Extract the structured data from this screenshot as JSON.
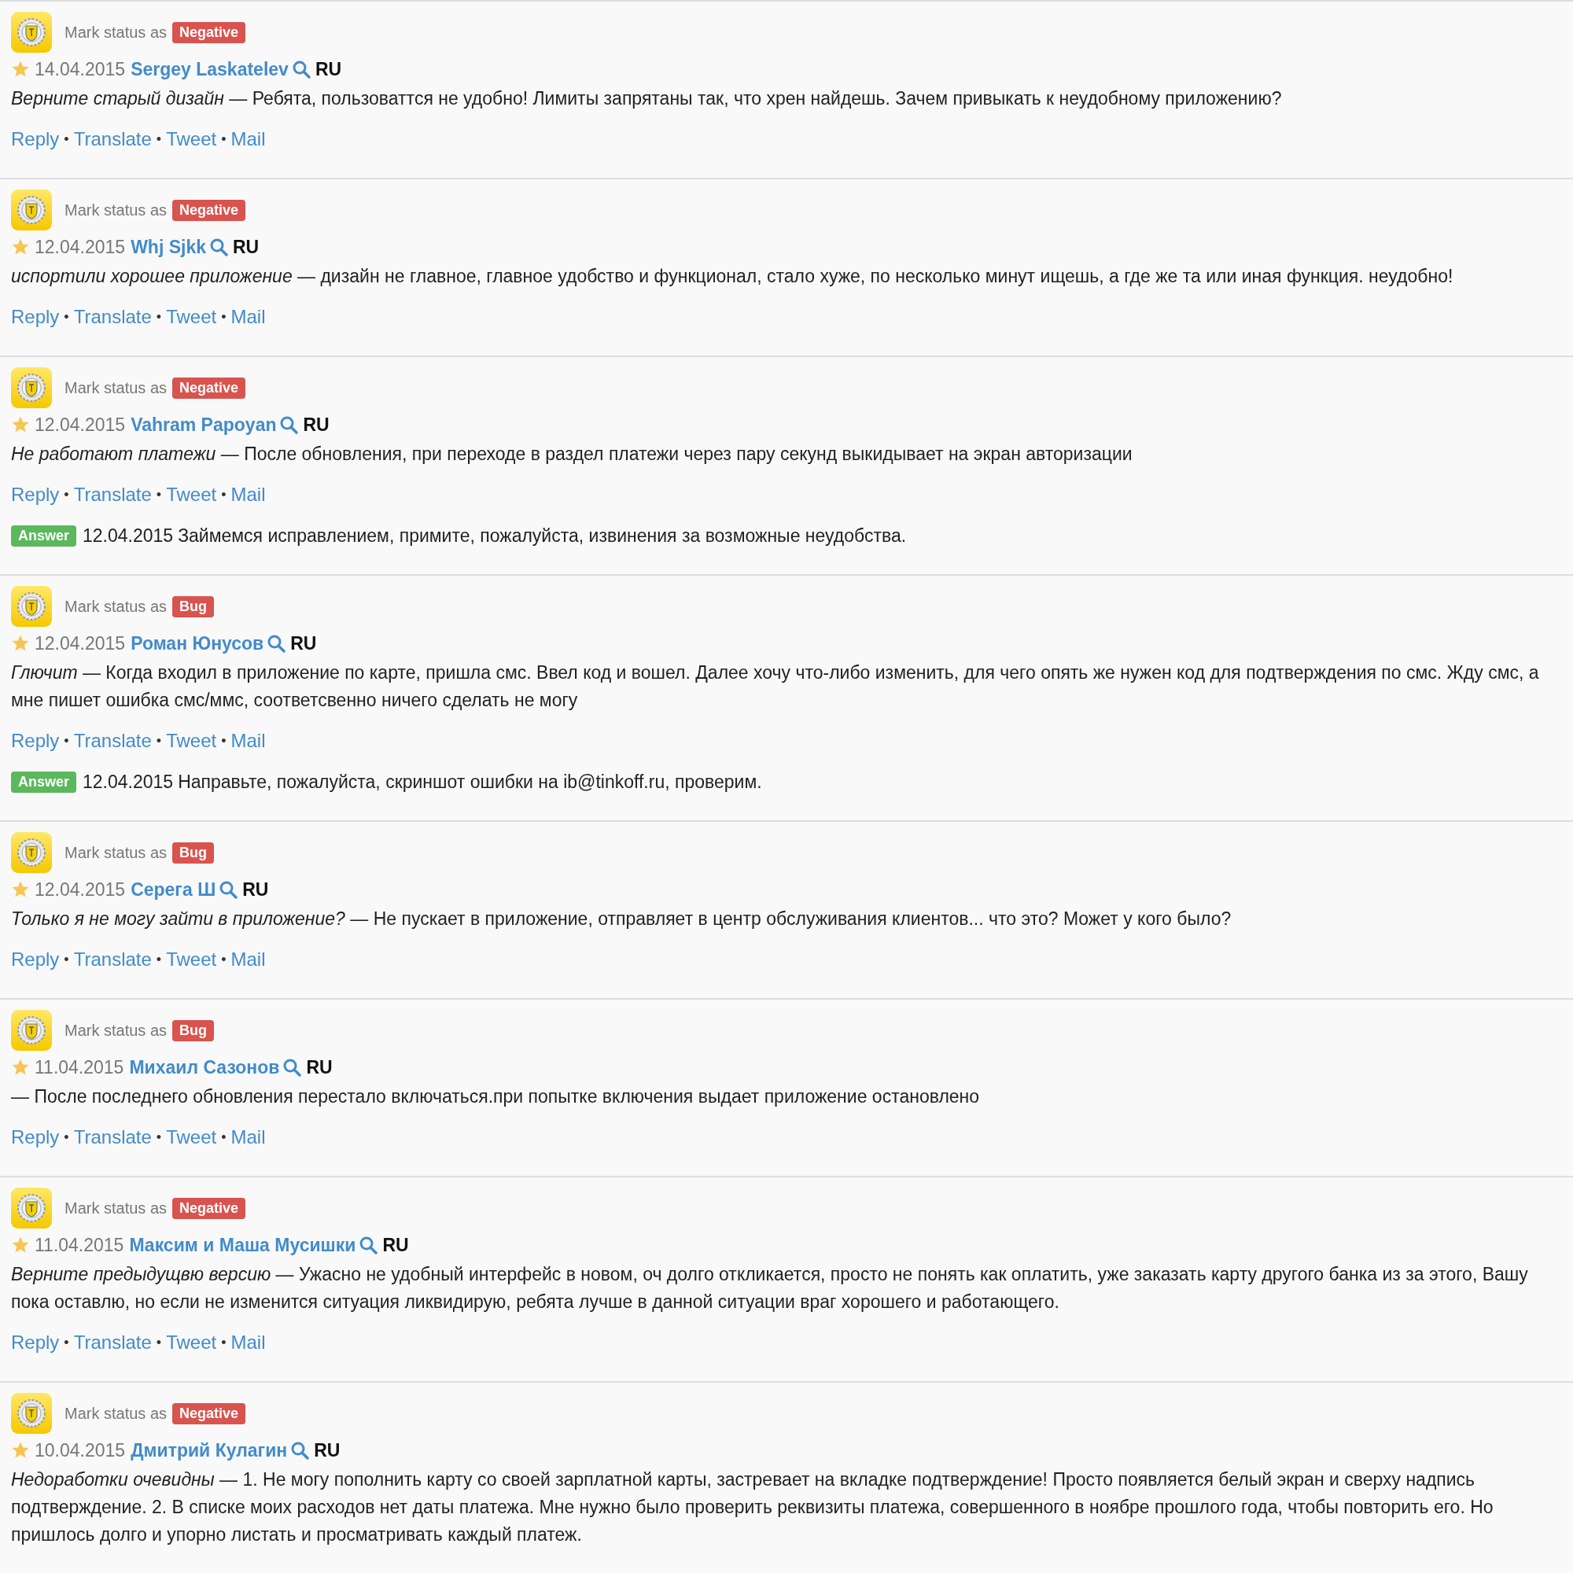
{
  "separator": "•",
  "reviews": [
    {
      "mark_label": "Mark status as",
      "status": "Negative",
      "date": "14.04.2015",
      "author": "Sergey Laskatelev",
      "country": "RU",
      "text": "*Верните старый дизайн* — Ребята, пользоваттся не удобно! Лимиты запрятаны так, что хрен найдешь. Зачем привыкать к неудобному приложению?",
      "links": [
        "Reply",
        "Translate",
        "Tweet",
        "Mail"
      ]
    },
    {
      "mark_label": "Mark status as",
      "status": "Negative",
      "date": "12.04.2015",
      "author": "Whj Sjkk",
      "country": "RU",
      "text": "*испортили хорошее приложение* — дизайн не главное, главное удобство и функционал, стало хуже, по несколько минут ищешь, а где же та или иная функция. неудобно!",
      "links": [
        "Reply",
        "Translate",
        "Tweet",
        "Mail"
      ]
    },
    {
      "mark_label": "Mark status as",
      "status": "Negative",
      "date": "12.04.2015",
      "author": "Vahram Papoyan",
      "country": "RU",
      "text": "*Не работают платежи* — После обновления, при переходе в раздел платежи через пару секунд выкидывает на экран авторизации",
      "links": [
        "Reply",
        "Translate",
        "Tweet",
        "Mail"
      ],
      "answer": {
        "label": "Answer",
        "date": "12.04.2015",
        "text": "Займемся исправлением, примите, пожалуйста, извинения за возможные неудобства."
      }
    },
    {
      "mark_label": "Mark status as",
      "status": "Bug",
      "date": "12.04.2015",
      "author": "Роман Юнусов",
      "country": "RU",
      "text": "*Глючит* — Когда входил в приложение по карте, пришла смс. Ввел код и вошел. Далее хочу что-либо изменить, для чего опять же нужен код для подтверждения по смс. Жду смс, а мне пишет ошибка смс/ммс, соответсвенно ничего сделать не могу",
      "links": [
        "Reply",
        "Translate",
        "Tweet",
        "Mail"
      ],
      "answer": {
        "label": "Answer",
        "date": "12.04.2015",
        "text": "Направьте, пожалуйста, скриншот ошибки на ib@tinkoff.ru, проверим."
      }
    },
    {
      "mark_label": "Mark status as",
      "status": "Bug",
      "date": "12.04.2015",
      "author": "Серега Ш",
      "country": "RU",
      "text": "*Только я не могу зайти в приложение?* — Не пускает в приложение, отправляет в центр обслуживания клиентов... что это? Может у кого было?",
      "links": [
        "Reply",
        "Translate",
        "Tweet",
        "Mail"
      ]
    },
    {
      "mark_label": "Mark status as",
      "status": "Bug",
      "date": "11.04.2015",
      "author": "Михаил Сазонов",
      "country": "RU",
      "text": "— После последнего обновления перестало включаться.при попытке включения выдает приложение остановлено",
      "links": [
        "Reply",
        "Translate",
        "Tweet",
        "Mail"
      ]
    },
    {
      "mark_label": "Mark status as",
      "status": "Negative",
      "date": "11.04.2015",
      "author": "Максим и Маша Мусишки",
      "country": "RU",
      "text": "*Верните предыдущвю версию* — Ужасно не удобный интерфейс в новом, оч долго откликается, просто не понять как оплатить, уже заказать карту другого банка из за этого, Вашу пока оставлю, но если не изменится ситуация ликвидирую, ребята лучше в данной ситуации враг хорошего и работающего.",
      "links": [
        "Reply",
        "Translate",
        "Tweet",
        "Mail"
      ]
    },
    {
      "mark_label": "Mark status as",
      "status": "Negative",
      "date": "10.04.2015",
      "author": "Дмитрий Кулагин",
      "country": "RU",
      "text": "*Недоработки очевидны* — 1. Не могу пополнить карту со своей зарплатной карты, застревает на вкладке подтверждение! Просто появляется белый экран и сверху надпись подтверждение. 2. В списке моих расходов нет даты платежа. Мне нужно было проверить реквизиты платежа, совершенного в ноябре прошлого года, чтобы повторить его. Но пришлось долго и упорно листать и просматривать каждый платеж."
    }
  ]
}
